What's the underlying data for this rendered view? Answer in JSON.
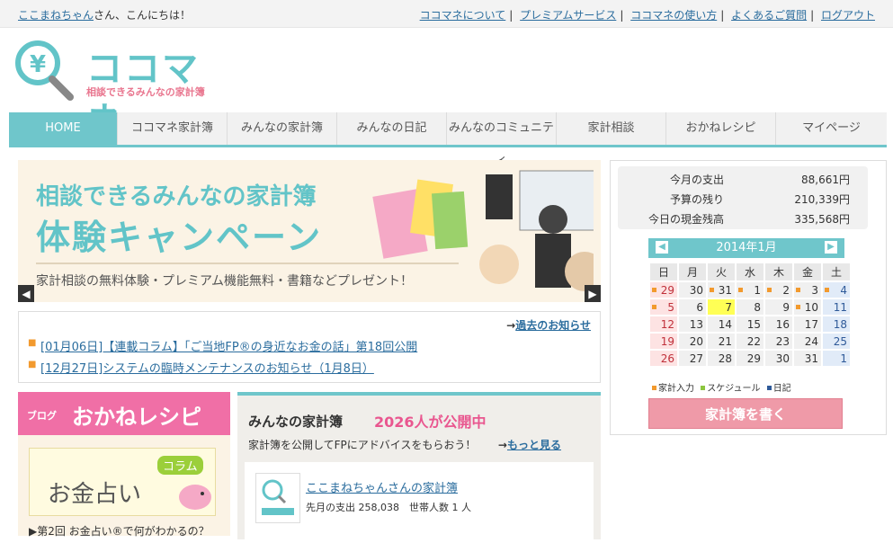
{
  "topbar": {
    "user_name": "ここまねちゃん",
    "greeting_suffix": "さん、こんにちは！",
    "links": [
      "ココマネについて",
      "プレミアムサービス",
      "ココマネの使い方",
      "よくあるご質問",
      "ログアウト"
    ]
  },
  "logo": {
    "title": "ココマネ",
    "subtitle": "相談できるみんなの家計簿"
  },
  "nav": [
    "HOME",
    "ココマネ家計簿",
    "みんなの家計簿",
    "みんなの日記",
    "みんなのコミュニティ",
    "家計相談",
    "おかねレシピ",
    "マイページ"
  ],
  "banner": {
    "line1": "相談できるみんなの家計簿",
    "line2": "体験キャンペーン",
    "line3": "家計相談の無料体験・プレミアム機能無料・書籍などプレゼント！"
  },
  "news": {
    "past_link": "過去のお知らせ",
    "items": [
      "[01月06日]【連載コラム】「ご当地FP®の身近なお金の話」第18回公開",
      "[12月27日]システムの臨時メンテナンスのお知らせ（1月8日）"
    ]
  },
  "blog": {
    "tag": "ブログ",
    "title": "おかねレシピ",
    "column_title": "お金占い",
    "column_tag": "コラム",
    "link": "▶第2回 お金占い®で何がわかるの？"
  },
  "minna": {
    "title": "みんなの家計簿",
    "count": "2026人が公開中",
    "subtitle": "家計簿を公開してFPにアドバイスをもらおう！",
    "more": "もっと見る",
    "card_link": "ここまねちゃんさんの家計簿",
    "card_info": "先月の支出 258,038　世帯人数 1 人"
  },
  "summary": [
    {
      "label": "今月の支出",
      "value": "88,661円"
    },
    {
      "label": "予算の残り",
      "value": "210,339円"
    },
    {
      "label": "今日の現金残高",
      "value": "335,568円"
    }
  ],
  "calendar": {
    "month": "2014年1月",
    "weekdays": [
      "日",
      "月",
      "火",
      "水",
      "木",
      "金",
      "土"
    ],
    "weeks": [
      [
        "29",
        "30",
        "31",
        "1",
        "2",
        "3",
        "4"
      ],
      [
        "5",
        "6",
        "7",
        "8",
        "9",
        "10",
        "11"
      ],
      [
        "12",
        "13",
        "14",
        "15",
        "16",
        "17",
        "18"
      ],
      [
        "19",
        "20",
        "21",
        "22",
        "23",
        "24",
        "25"
      ],
      [
        "26",
        "27",
        "28",
        "29",
        "30",
        "31",
        "1"
      ]
    ],
    "legend": [
      "家計入力",
      "スケジュール",
      "日記"
    ],
    "legend_colors": [
      "#f29a2e",
      "#8cc63f",
      "#2f5a99"
    ]
  },
  "write_button": "家計簿を書く"
}
